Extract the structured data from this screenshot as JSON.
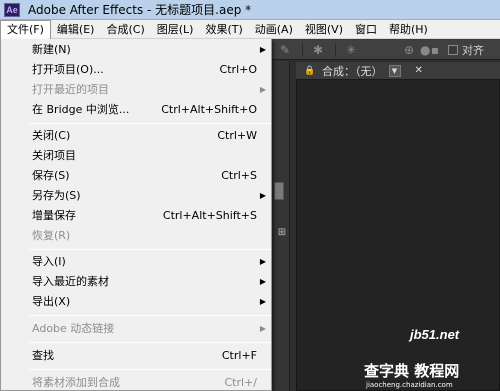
{
  "window": {
    "title": "Adobe After Effects - 无标题项目.aep *",
    "logo": "Ae"
  },
  "menubar": {
    "items": [
      {
        "label": "文件(F)"
      },
      {
        "label": "编辑(E)"
      },
      {
        "label": "合成(C)"
      },
      {
        "label": "图层(L)"
      },
      {
        "label": "效果(T)"
      },
      {
        "label": "动画(A)"
      },
      {
        "label": "视图(V)"
      },
      {
        "label": "窗口"
      },
      {
        "label": "帮助(H)"
      }
    ]
  },
  "file_menu": {
    "items": [
      {
        "label": "新建(N)",
        "shortcut": "",
        "submenu": true,
        "disabled": false
      },
      {
        "label": "打开项目(O)...",
        "shortcut": "Ctrl+O",
        "submenu": false,
        "disabled": false
      },
      {
        "label": "打开最近的项目",
        "shortcut": "",
        "submenu": true,
        "disabled": true
      },
      {
        "label": "在 Bridge 中浏览...",
        "shortcut": "Ctrl+Alt+Shift+O",
        "submenu": false,
        "disabled": false
      },
      {
        "label": "关闭(C)",
        "shortcut": "Ctrl+W",
        "submenu": false,
        "disabled": false
      },
      {
        "label": "关闭项目",
        "shortcut": "",
        "submenu": false,
        "disabled": false
      },
      {
        "label": "保存(S)",
        "shortcut": "Ctrl+S",
        "submenu": false,
        "disabled": false
      },
      {
        "label": "另存为(S)",
        "shortcut": "",
        "submenu": true,
        "disabled": false
      },
      {
        "label": "增量保存",
        "shortcut": "Ctrl+Alt+Shift+S",
        "submenu": false,
        "disabled": false
      },
      {
        "label": "恢复(R)",
        "shortcut": "",
        "submenu": false,
        "disabled": true
      },
      {
        "label": "导入(I)",
        "shortcut": "",
        "submenu": true,
        "disabled": false
      },
      {
        "label": "导入最近的素材",
        "shortcut": "",
        "submenu": true,
        "disabled": false
      },
      {
        "label": "导出(X)",
        "shortcut": "",
        "submenu": true,
        "disabled": false
      },
      {
        "label": "Adobe 动态链接",
        "shortcut": "",
        "submenu": true,
        "disabled": true
      },
      {
        "label": "查找",
        "shortcut": "Ctrl+F",
        "submenu": false,
        "disabled": false
      },
      {
        "label": "将素材添加到合成",
        "shortcut": "Ctrl+/",
        "submenu": false,
        "disabled": true
      }
    ]
  },
  "toolbar": {
    "align_label": "对齐"
  },
  "comp_panel": {
    "tab_label": "合成：（无）",
    "dropdown_glyph": "▼",
    "menu_glyph": "✕"
  },
  "watermark": {
    "brand": "jb51.net",
    "text": "查字典 教程网",
    "url": "jiaocheng.chazidian.com"
  },
  "colors": {
    "menu_bg": "#f0f0f0",
    "app_bg": "#2e2e2e",
    "titlebar": "#b9d1ea"
  }
}
